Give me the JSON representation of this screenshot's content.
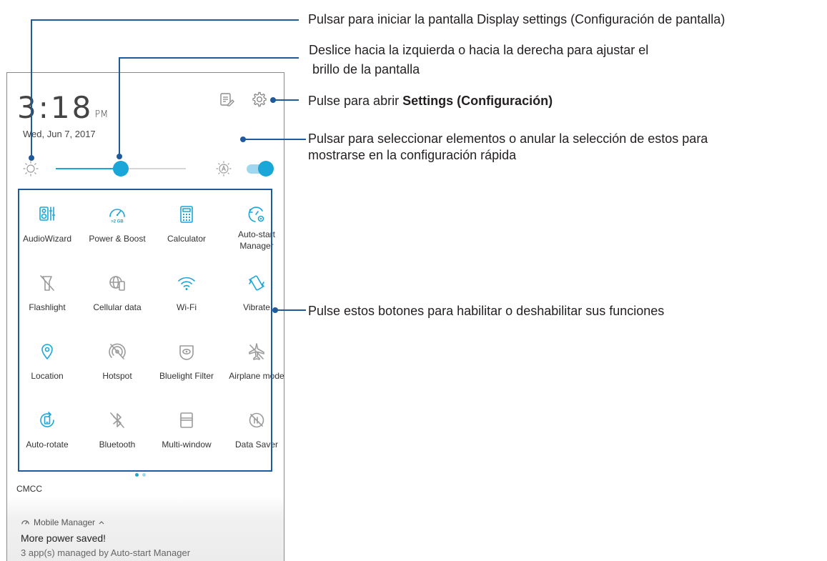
{
  "status": {
    "time": "3:18",
    "ampm": "PM",
    "date": "Wed, Jun 7, 2017"
  },
  "brightness": {
    "level": 0.5,
    "auto_enabled": true
  },
  "tiles": [
    {
      "label": "AudioWizard",
      "icon": "audiowizard-icon",
      "active": true
    },
    {
      "label": "Power & Boost",
      "icon": "power-boost-icon",
      "active": true,
      "badge": ">2 GB"
    },
    {
      "label": "Calculator",
      "icon": "calculator-icon",
      "active": true
    },
    {
      "label": "Auto-start\nManager",
      "icon": "auto-start-manager-icon",
      "active": true
    },
    {
      "label": "Flashlight",
      "icon": "flashlight-icon",
      "active": false
    },
    {
      "label": "Cellular data",
      "icon": "cellular-data-icon",
      "active": false
    },
    {
      "label": "Wi-Fi",
      "icon": "wifi-icon",
      "active": true
    },
    {
      "label": "Vibrate",
      "icon": "vibrate-icon",
      "active": true
    },
    {
      "label": "Location",
      "icon": "location-icon",
      "active": true
    },
    {
      "label": "Hotspot",
      "icon": "hotspot-icon",
      "active": false
    },
    {
      "label": "Bluelight Filter",
      "icon": "bluelight-filter-icon",
      "active": false
    },
    {
      "label": "Airplane mode",
      "icon": "airplane-icon",
      "active": false
    },
    {
      "label": "Auto-rotate",
      "icon": "auto-rotate-icon",
      "active": true
    },
    {
      "label": "Bluetooth",
      "icon": "bluetooth-icon",
      "active": false
    },
    {
      "label": "Multi-window",
      "icon": "multi-window-icon",
      "active": false
    },
    {
      "label": "Data Saver",
      "icon": "data-saver-icon",
      "active": false
    }
  ],
  "carrier": "CMCC",
  "notification": {
    "app": "Mobile Manager",
    "title": "More power saved!",
    "text": "3 app(s) managed by Auto-start Manager"
  },
  "callouts": {
    "display_settings": "Pulsar para iniciar la pantalla Display settings (Configuración de pantalla)",
    "brightness_line1": "Deslice hacia la izquierda o hacia la derecha para ajustar el",
    "brightness_line2": " brillo de la pantalla",
    "settings_prefix": "Pulse para abrir ",
    "settings_bold": "Settings (Configuración)",
    "edit_line1": "Pulsar para seleccionar elementos o anular la selección de estos para",
    "edit_line2": "mostrarse en la configuración rápida",
    "tiles": "Pulse estos botones para habilitar o deshabilitar sus funciones"
  },
  "colors": {
    "accent": "#1aa6d8",
    "inactive": "#9b9b9b",
    "callout": "#1f5a9c"
  }
}
